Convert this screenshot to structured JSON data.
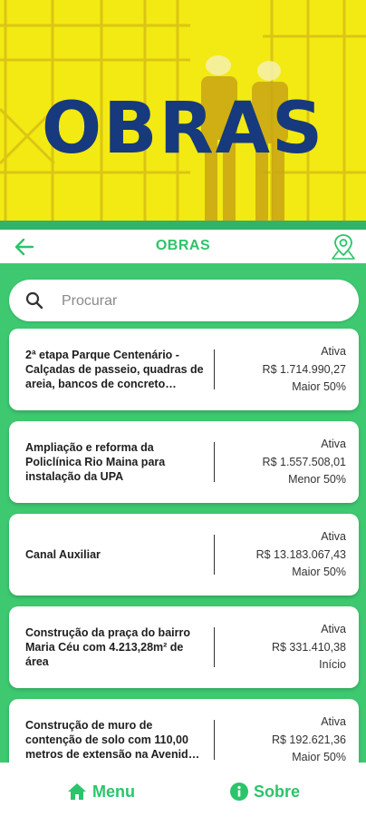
{
  "banner": {
    "title": "OBRAS"
  },
  "header": {
    "title": "OBRAS"
  },
  "search": {
    "placeholder": "Procurar"
  },
  "works": [
    {
      "name": "2ª etapa Parque Centenário - Calçadas de passeio, quadras de areia, bancos de concreto…",
      "status": "Ativa",
      "value": "R$ 1.714.990,27",
      "progress": "Maior 50%"
    },
    {
      "name": "Ampliação e reforma da Policlínica Rio Maina para instalação da UPA",
      "status": "Ativa",
      "value": "R$ 1.557.508,01",
      "progress": "Menor 50%"
    },
    {
      "name": "Canal Auxiliar",
      "status": "Ativa",
      "value": "R$ 13.183.067,43",
      "progress": "Maior 50%"
    },
    {
      "name": "Construção da praça do bairro Maria Céu com 4.213,28m² de área",
      "status": "Ativa",
      "value": "R$ 331.410,38",
      "progress": "Início"
    },
    {
      "name": "Construção de muro de contenção de solo com 110,00 metros de extensão na Avenid…",
      "status": "Ativa",
      "value": "R$ 192.621,36",
      "progress": "Maior 50%"
    }
  ],
  "bottom_nav": {
    "menu_label": "Menu",
    "about_label": "Sobre"
  },
  "colors": {
    "accent": "#2cc46a",
    "list_background": "#3ec971",
    "banner_yellow": "#f2ea12",
    "banner_title": "#163a7d"
  }
}
